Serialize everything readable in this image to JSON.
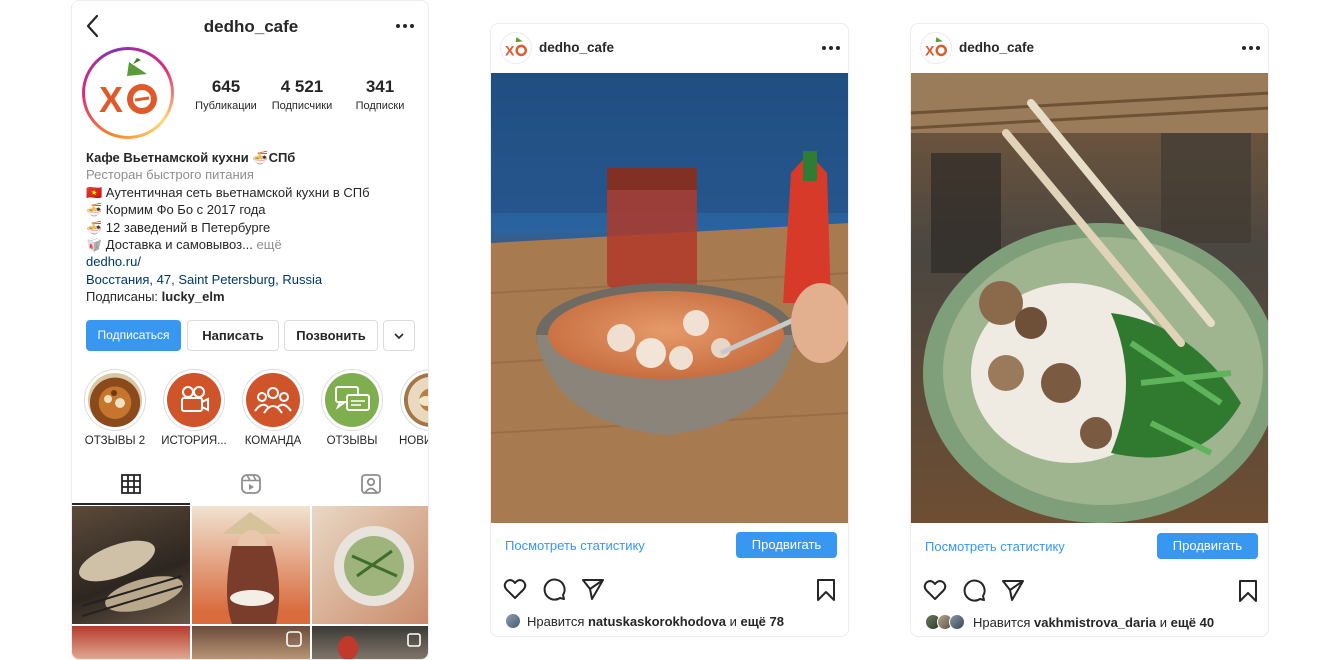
{
  "profile": {
    "username": "dedho_cafe",
    "avatar_logo_text": "XO",
    "stats": [
      {
        "value": "645",
        "label": "Публикации"
      },
      {
        "value": "4 521",
        "label": "Подписчики"
      },
      {
        "value": "341",
        "label": "Подписки"
      }
    ],
    "bio": {
      "name": "Кафе Вьетнамской кухни 🍜СПб",
      "category": "Ресторан быстрого питания",
      "lines": [
        "🇻🇳 Аутентичная сеть вьетнамской кухни в СПб",
        "🍜 Кормим Фо Бо с 2017 года",
        "🍜 12 заведений в Петербурге",
        "🥡 Доставка и самовывоз..."
      ],
      "more": " ещё",
      "website": "dedho.ru/",
      "address": "Восстания, 47, Saint Petersburg, Russia",
      "followed_by_prefix": "Подписаны: ",
      "followed_by_user": "lucky_elm"
    },
    "buttons": {
      "follow": "Подписаться",
      "message": "Написать",
      "call": "Позвонить"
    },
    "highlights": [
      {
        "label": "ОТЗЫВЫ 2",
        "icon": "soup-photo"
      },
      {
        "label": "ИСТОРИЯ...",
        "icon": "camera-icon"
      },
      {
        "label": "КОМАНДА",
        "icon": "team-icon"
      },
      {
        "label": "ОТЗЫВЫ",
        "icon": "chat-icon"
      },
      {
        "label": "НОВИ",
        "icon": "food-photo"
      }
    ],
    "tabs": [
      "grid-icon",
      "reels-icon",
      "tagged-icon"
    ]
  },
  "posts": [
    {
      "username": "dedho_cafe",
      "stats_link": "Посмотреть статистику",
      "promote": "Продвигать",
      "likes_prefix": "Нравится ",
      "likes_user": "natuskaskorokhodova",
      "likes_mid": " и ",
      "likes_more": "ещё 78"
    },
    {
      "username": "dedho_cafe",
      "stats_link": "Посмотреть статистику",
      "promote": "Продвигать",
      "likes_prefix": "Нравится ",
      "likes_user": "vakhmistrova_daria",
      "likes_mid": " и ",
      "likes_more": "ещё 40"
    }
  ],
  "colors": {
    "accent": "#3897f0",
    "brand_orange": "#e0592a",
    "brand_green": "#5a9a3b",
    "link": "#00376b"
  }
}
